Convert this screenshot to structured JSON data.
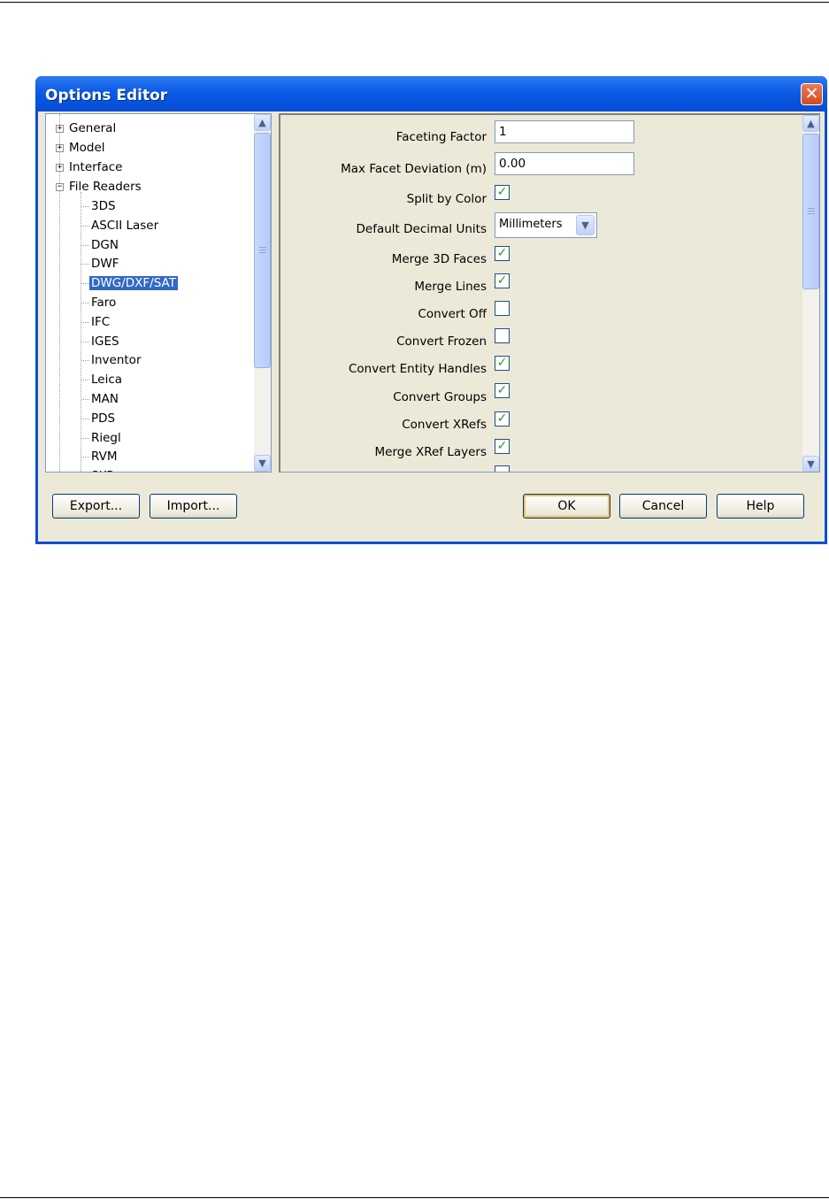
{
  "window": {
    "title": "Options Editor",
    "close_label": "✕"
  },
  "tree": {
    "top_nodes": [
      {
        "label": "General",
        "expander": "+"
      },
      {
        "label": "Model",
        "expander": "+"
      },
      {
        "label": "Interface",
        "expander": "+"
      },
      {
        "label": "File Readers",
        "expander": "−"
      }
    ],
    "children": [
      "3DS",
      "ASCII Laser",
      "DGN",
      "DWF",
      "DWG/DXF/SAT",
      "Faro",
      "IFC",
      "IGES",
      "Inventor",
      "Leica",
      "MAN",
      "PDS",
      "Riegl",
      "RVM",
      "SKP"
    ],
    "selected": "DWG/DXF/SAT"
  },
  "form": {
    "faceting_factor_label": "Faceting Factor",
    "faceting_factor_value": "1",
    "max_facet_label": "Max Facet Deviation (m)",
    "max_facet_value": "0.00",
    "split_by_color_label": "Split by Color",
    "split_by_color_checked": true,
    "default_units_label": "Default Decimal Units",
    "default_units_value": "Millimeters",
    "merge_3d_faces_label": "Merge 3D Faces",
    "merge_3d_faces_checked": true,
    "merge_lines_label": "Merge Lines",
    "merge_lines_checked": true,
    "convert_off_label": "Convert Off",
    "convert_off_checked": false,
    "convert_frozen_label": "Convert Frozen",
    "convert_frozen_checked": false,
    "convert_entity_handles_label": "Convert Entity Handles",
    "convert_entity_handles_checked": true,
    "convert_groups_label": "Convert Groups",
    "convert_groups_checked": true,
    "convert_xrefs_label": "Convert XRefs",
    "convert_xrefs_checked": true,
    "merge_xref_layers_label": "Merge XRef Layers",
    "merge_xref_layers_checked": true,
    "check_mark": "✓"
  },
  "buttons": {
    "export": "Export...",
    "import": "Import...",
    "ok": "OK",
    "cancel": "Cancel",
    "help": "Help"
  },
  "icons": {
    "scroll_up": "▲",
    "scroll_down": "▼",
    "dropdown": "▼"
  },
  "colors": {
    "titlebar": "#0a5be6",
    "selection": "#316ac5",
    "dialog_bg": "#ece9d8",
    "close_button": "#d34a1c",
    "check": "#21a121"
  }
}
